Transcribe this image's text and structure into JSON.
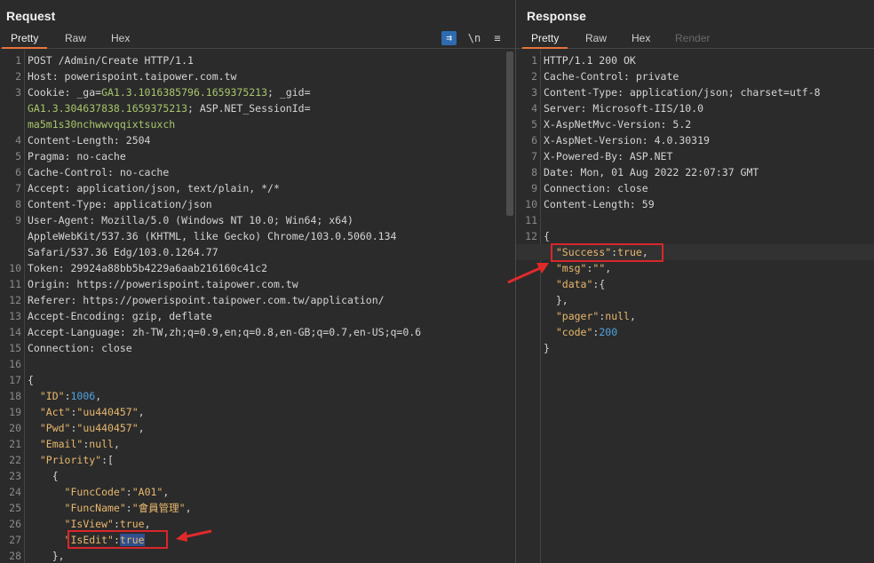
{
  "request": {
    "title": "Request",
    "tabs": [
      "Pretty",
      "Raw",
      "Hex"
    ],
    "tools": {
      "wrap": "⇉",
      "newline": "\\n",
      "menu": "≡"
    },
    "lines": [
      {
        "n": "1",
        "parts": [
          [
            "k",
            "POST /Admin/Create HTTP/1.1"
          ]
        ]
      },
      {
        "n": "2",
        "parts": [
          [
            "k",
            "Host: powerispoint.taipower.com.tw"
          ]
        ]
      },
      {
        "n": "3",
        "parts": [
          [
            "k",
            "Cookie: _ga="
          ],
          [
            "cg",
            "GA1.3.1016385796.1659375213"
          ],
          [
            "k",
            "; _gid="
          ]
        ]
      },
      {
        "n": "",
        "parts": [
          [
            "cg",
            "GA1.3.304637838.1659375213"
          ],
          [
            "k",
            "; ASP.NET_SessionId="
          ]
        ]
      },
      {
        "n": "",
        "parts": [
          [
            "cg",
            "ma5m1s30nchwwvqqixtsuxch"
          ]
        ]
      },
      {
        "n": "4",
        "parts": [
          [
            "k",
            "Content-Length: 2504"
          ]
        ]
      },
      {
        "n": "5",
        "parts": [
          [
            "k",
            "Pragma: no-cache"
          ]
        ]
      },
      {
        "n": "6",
        "parts": [
          [
            "k",
            "Cache-Control: no-cache"
          ]
        ]
      },
      {
        "n": "7",
        "parts": [
          [
            "k",
            "Accept: application/json, text/plain, */*"
          ]
        ]
      },
      {
        "n": "8",
        "parts": [
          [
            "k",
            "Content-Type: application/json"
          ]
        ]
      },
      {
        "n": "9",
        "parts": [
          [
            "k",
            "User-Agent: Mozilla/5.0 (Windows NT 10.0; Win64; x64)"
          ]
        ]
      },
      {
        "n": "",
        "parts": [
          [
            "k",
            "AppleWebKit/537.36 (KHTML, like Gecko) Chrome/103.0.5060.134"
          ]
        ]
      },
      {
        "n": "",
        "parts": [
          [
            "k",
            "Safari/537.36 Edg/103.0.1264.77"
          ]
        ]
      },
      {
        "n": "10",
        "parts": [
          [
            "k",
            "Token: 29924a88bb5b4229a6aab216160c41c2"
          ]
        ]
      },
      {
        "n": "11",
        "parts": [
          [
            "k",
            "Origin: https://powerispoint.taipower.com.tw"
          ]
        ]
      },
      {
        "n": "12",
        "parts": [
          [
            "k",
            "Referer: https://powerispoint.taipower.com.tw/application/"
          ]
        ]
      },
      {
        "n": "13",
        "parts": [
          [
            "k",
            "Accept-Encoding: gzip, deflate"
          ]
        ]
      },
      {
        "n": "14",
        "parts": [
          [
            "k",
            "Accept-Language: zh-TW,zh;q=0.9,en;q=0.8,en-GB;q=0.7,en-US;q=0.6"
          ]
        ]
      },
      {
        "n": "15",
        "parts": [
          [
            "k",
            "Connection: close"
          ]
        ]
      },
      {
        "n": "16",
        "parts": []
      },
      {
        "n": "17",
        "parts": [
          [
            "k",
            "{"
          ]
        ]
      },
      {
        "n": "18",
        "parts": [
          [
            "k",
            "  "
          ],
          [
            "jk",
            "\"ID\""
          ],
          [
            "k",
            ":"
          ],
          [
            "jnum",
            "1006"
          ],
          [
            "k",
            ","
          ]
        ]
      },
      {
        "n": "19",
        "parts": [
          [
            "k",
            "  "
          ],
          [
            "jk",
            "\"Act\""
          ],
          [
            "k",
            ":"
          ],
          [
            "jstr",
            "\"uu440457\""
          ],
          [
            "k",
            ","
          ]
        ]
      },
      {
        "n": "20",
        "parts": [
          [
            "k",
            "  "
          ],
          [
            "jk",
            "\"Pwd\""
          ],
          [
            "k",
            ":"
          ],
          [
            "jstr",
            "\"uu440457\""
          ],
          [
            "k",
            ","
          ]
        ]
      },
      {
        "n": "21",
        "parts": [
          [
            "k",
            "  "
          ],
          [
            "jk",
            "\"Email\""
          ],
          [
            "k",
            ":"
          ],
          [
            "jkw",
            "null"
          ],
          [
            "k",
            ","
          ]
        ]
      },
      {
        "n": "22",
        "parts": [
          [
            "k",
            "  "
          ],
          [
            "jk",
            "\"Priority\""
          ],
          [
            "k",
            ":["
          ]
        ]
      },
      {
        "n": "23",
        "parts": [
          [
            "k",
            "    {"
          ]
        ]
      },
      {
        "n": "24",
        "parts": [
          [
            "k",
            "      "
          ],
          [
            "jk",
            "\"FuncCode\""
          ],
          [
            "k",
            ":"
          ],
          [
            "jstr",
            "\"A01\""
          ],
          [
            "k",
            ","
          ]
        ]
      },
      {
        "n": "25",
        "parts": [
          [
            "k",
            "      "
          ],
          [
            "jk",
            "\"FuncName\""
          ],
          [
            "k",
            ":"
          ],
          [
            "jstr",
            "\"會員管理\""
          ],
          [
            "k",
            ","
          ]
        ]
      },
      {
        "n": "26",
        "parts": [
          [
            "k",
            "      "
          ],
          [
            "jk",
            "\"IsView\""
          ],
          [
            "k",
            ":"
          ],
          [
            "jkw",
            "true"
          ],
          [
            "k",
            ","
          ]
        ]
      },
      {
        "n": "27",
        "parts": [
          [
            "k",
            "      "
          ],
          [
            "jk",
            "\"IsEdit\""
          ],
          [
            "k",
            ":"
          ],
          [
            "sel",
            "true"
          ]
        ]
      },
      {
        "n": "28",
        "parts": [
          [
            "k",
            "    },"
          ]
        ]
      }
    ]
  },
  "response": {
    "title": "Response",
    "tabs": [
      "Pretty",
      "Raw",
      "Hex",
      "Render"
    ],
    "lines": [
      {
        "n": "1",
        "parts": [
          [
            "k",
            "HTTP/1.1 200 OK"
          ]
        ]
      },
      {
        "n": "2",
        "parts": [
          [
            "k",
            "Cache-Control: private"
          ]
        ]
      },
      {
        "n": "3",
        "parts": [
          [
            "k",
            "Content-Type: application/json; charset=utf-8"
          ]
        ]
      },
      {
        "n": "4",
        "parts": [
          [
            "k",
            "Server: Microsoft-IIS/10.0"
          ]
        ]
      },
      {
        "n": "5",
        "parts": [
          [
            "k",
            "X-AspNetMvc-Version: 5.2"
          ]
        ]
      },
      {
        "n": "6",
        "parts": [
          [
            "k",
            "X-AspNet-Version: 4.0.30319"
          ]
        ]
      },
      {
        "n": "7",
        "parts": [
          [
            "k",
            "X-Powered-By: ASP.NET"
          ]
        ]
      },
      {
        "n": "8",
        "parts": [
          [
            "k",
            "Date: Mon, 01 Aug 2022 22:07:37 GMT"
          ]
        ]
      },
      {
        "n": "9",
        "parts": [
          [
            "k",
            "Connection: close"
          ]
        ]
      },
      {
        "n": "10",
        "parts": [
          [
            "k",
            "Content-Length: 59"
          ]
        ]
      },
      {
        "n": "11",
        "parts": []
      },
      {
        "n": "12",
        "parts": [
          [
            "k",
            "{"
          ]
        ]
      },
      {
        "n": "",
        "parts": [
          [
            "k",
            "  "
          ],
          [
            "jk",
            "\"Success\""
          ],
          [
            "k",
            ":"
          ],
          [
            "jkw",
            "true"
          ],
          [
            "k",
            ","
          ]
        ]
      },
      {
        "n": "",
        "parts": [
          [
            "k",
            "  "
          ],
          [
            "jk",
            "\"msg\""
          ],
          [
            "k",
            ":"
          ],
          [
            "jstr",
            "\"\""
          ],
          [
            "k",
            ","
          ]
        ]
      },
      {
        "n": "",
        "parts": [
          [
            "k",
            "  "
          ],
          [
            "jk",
            "\"data\""
          ],
          [
            "k",
            ":{"
          ]
        ]
      },
      {
        "n": "",
        "parts": [
          [
            "k",
            "  },"
          ]
        ]
      },
      {
        "n": "",
        "parts": [
          [
            "k",
            "  "
          ],
          [
            "jk",
            "\"pager\""
          ],
          [
            "k",
            ":"
          ],
          [
            "jkw",
            "null"
          ],
          [
            "k",
            ","
          ]
        ]
      },
      {
        "n": "",
        "parts": [
          [
            "k",
            "  "
          ],
          [
            "jk",
            "\"code\""
          ],
          [
            "k",
            ":"
          ],
          [
            "jnum",
            "200"
          ]
        ]
      },
      {
        "n": "",
        "parts": [
          [
            "k",
            "}"
          ]
        ]
      }
    ]
  }
}
